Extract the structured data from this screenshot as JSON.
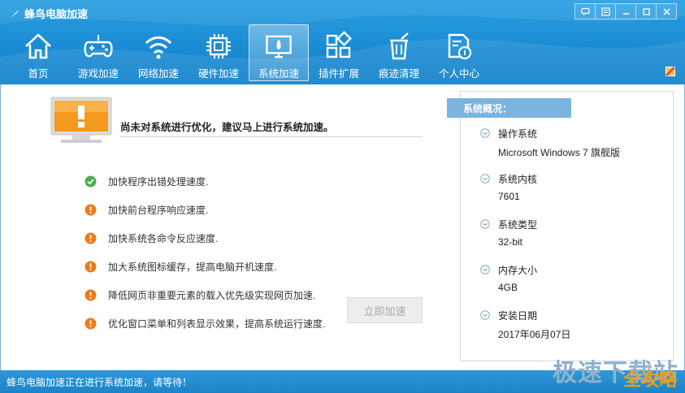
{
  "window": {
    "title": "蜂鸟电脑加速"
  },
  "nav": [
    {
      "id": "home",
      "label": "首页",
      "icon": "home-icon"
    },
    {
      "id": "game",
      "label": "游戏加速",
      "icon": "gamepad-icon"
    },
    {
      "id": "network",
      "label": "网络加速",
      "icon": "wifi-icon"
    },
    {
      "id": "hardware",
      "label": "硬件加速",
      "icon": "chip-icon"
    },
    {
      "id": "system",
      "label": "系统加速",
      "icon": "monitor-rocket-icon",
      "active": true
    },
    {
      "id": "plugin",
      "label": "插件扩展",
      "icon": "grid-icon"
    },
    {
      "id": "cleanup",
      "label": "痕迹清理",
      "icon": "trash-icon"
    },
    {
      "id": "user",
      "label": "个人中心",
      "icon": "user-doc-icon"
    }
  ],
  "main": {
    "headline": "尚未对系统进行优化，建议马上进行系统加速。",
    "items": [
      {
        "text": "加快程序出错处理速度.",
        "status": "ok"
      },
      {
        "text": "加快前台程序响应速度.",
        "status": "warn"
      },
      {
        "text": "加快系统各命令反应速度.",
        "status": "warn"
      },
      {
        "text": "加大系统图标缓存，提高电脑开机速度.",
        "status": "warn"
      },
      {
        "text": "降低网页非重要元素的载入优先级实现网页加速.",
        "status": "warn"
      },
      {
        "text": "优化窗口菜单和列表显示效果，提高系统运行速度.",
        "status": "warn"
      }
    ],
    "accelerate_button": "立即加速"
  },
  "sys": {
    "header": "系统概况：",
    "rows": [
      {
        "label": "操作系统",
        "value": "Microsoft Windows 7 旗舰版"
      },
      {
        "label": "系统内核",
        "value": "7601"
      },
      {
        "label": "系统类型",
        "value": "32-bit"
      },
      {
        "label": "内存大小",
        "value": "4GB"
      },
      {
        "label": "安装日期",
        "value": "2017年06月07日"
      }
    ]
  },
  "status_text": "蜂鸟电脑加速正在进行系统加速，请等待！",
  "watermark": {
    "line1": "极速下载站",
    "line2": "全攻略"
  },
  "colors": {
    "header": "#1d8fd6",
    "ok": "#4caf50",
    "warn": "#f07a1a",
    "panel_header": "#7bb4df"
  }
}
